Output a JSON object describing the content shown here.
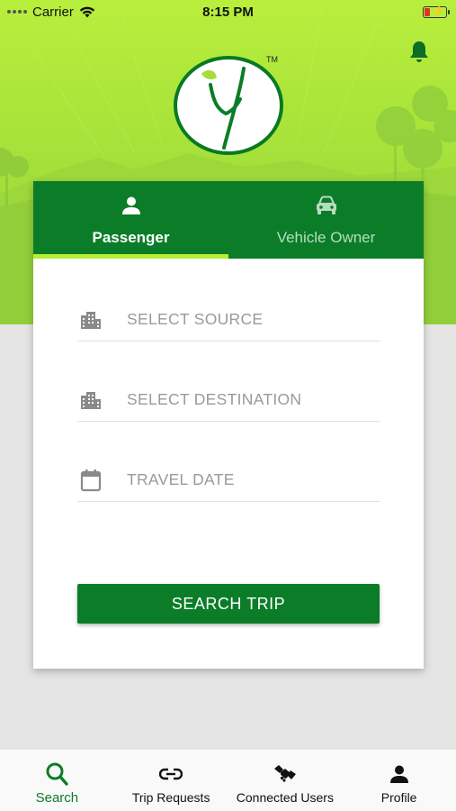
{
  "status_bar": {
    "carrier": "Carrier",
    "time": "8:15 PM"
  },
  "header": {
    "logo_mark": "TM",
    "bell_icon": "bell-icon"
  },
  "tabs": [
    {
      "label": "Passenger",
      "icon": "person-icon",
      "active": true
    },
    {
      "label": "Vehicle Owner",
      "icon": "car-icon",
      "active": false
    }
  ],
  "form": {
    "source_placeholder": "SELECT SOURCE",
    "destination_placeholder": "SELECT DESTINATION",
    "date_placeholder": "TRAVEL DATE",
    "source_icon": "building-icon",
    "destination_icon": "building-icon",
    "date_icon": "calendar-icon",
    "search_label": "SEARCH TRIP"
  },
  "bottom_nav": [
    {
      "label": "Search",
      "icon": "search-icon",
      "active": true
    },
    {
      "label": "Trip Requests",
      "icon": "link-icon",
      "active": false
    },
    {
      "label": "Connected Users",
      "icon": "handshake-icon",
      "active": false
    },
    {
      "label": "Profile",
      "icon": "person-icon",
      "active": false
    }
  ],
  "colors": {
    "primary_green": "#0b7d28",
    "accent_lime": "#b5ee32",
    "hero_green": "#a6e23a",
    "battery_low": "#e0332a"
  }
}
